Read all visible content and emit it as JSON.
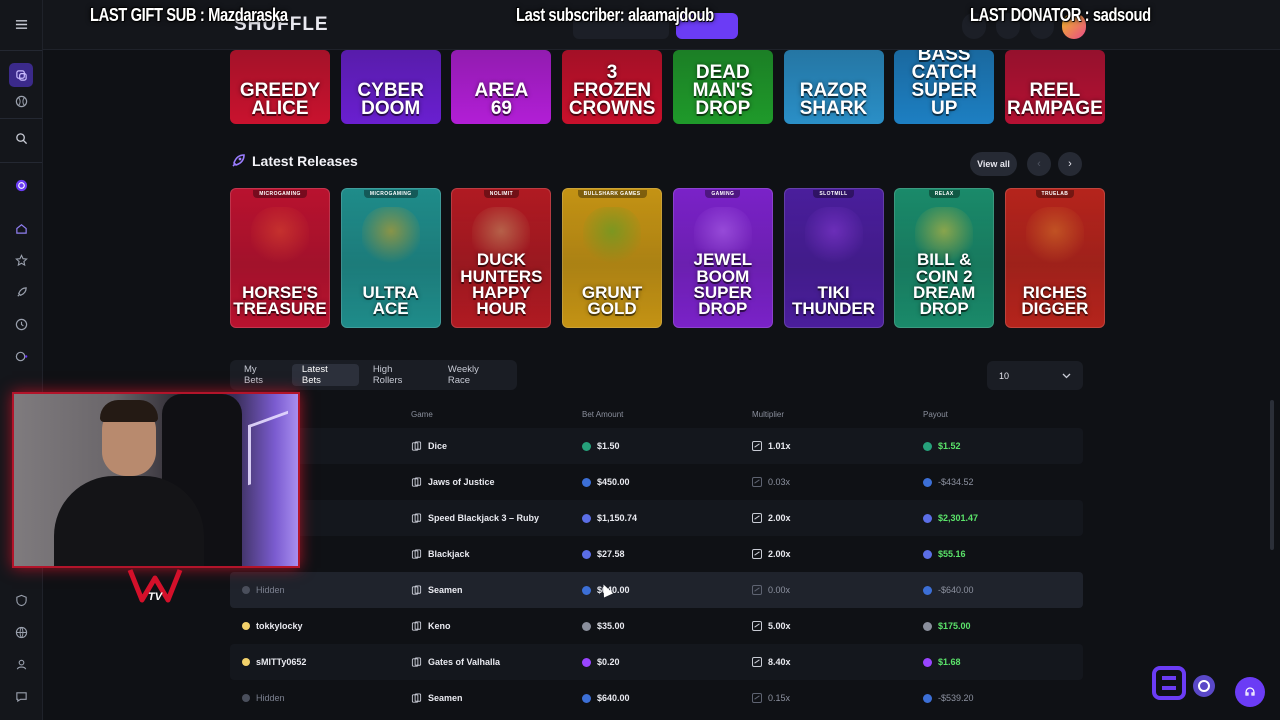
{
  "overlay": {
    "last_gift_sub": "LAST GIFT SUB : Mazdaraska",
    "last_subscriber": "Last subscriber: alaamajdoub",
    "last_donator": "LAST DONATOR : sadsoud"
  },
  "app": {
    "logo_text": "SHUFFLE"
  },
  "top_row_games": [
    {
      "title": "GREEDY\nALICE",
      "bg": "#c9122e"
    },
    {
      "title": "CYBER\nDOOM",
      "bg": "#6a1fd0"
    },
    {
      "title": "AREA\n69",
      "bg": "#b21ed6"
    },
    {
      "title": "3 FROZEN\nCROWNS",
      "bg": "#c8102b"
    },
    {
      "title": "DEAD MAN'S\nDROP",
      "bg": "#1f9a2a"
    },
    {
      "title": "RAZOR\nSHARK",
      "bg": "#2a8fc7"
    },
    {
      "title": "BASS CATCH\nSUPER UP",
      "bg": "#1d7fc2"
    },
    {
      "title": "REEL\nRAMPAGE",
      "bg": "#b61133"
    }
  ],
  "latest_releases": {
    "title": "Latest Releases",
    "view_all": "View all",
    "games": [
      {
        "title": "HORSE'S\nTREASURE",
        "provider": "MICROGAMING",
        "bg": "#b9122f",
        "accent": "#d94a2e"
      },
      {
        "title": "ULTRA\nACE",
        "provider": "MICROGAMING",
        "bg": "#1f8c8a",
        "accent": "#e0a21a"
      },
      {
        "title": "DUCK HUNTERS\nHAPPY HOUR",
        "provider": "NOLIMIT",
        "bg": "#b01a22",
        "accent": "#c49a6a"
      },
      {
        "title": "GRUNT\nGOLD",
        "provider": "BULLSHARK GAMES",
        "bg": "#c49314",
        "accent": "#4da12a"
      },
      {
        "title": "JEWEL BOOM\nSUPER DROP",
        "provider": "GAMING",
        "bg": "#7a22c8",
        "accent": "#b46cf0"
      },
      {
        "title": "TIKI\nTHUNDER",
        "provider": "SLOTMILL",
        "bg": "#4a1e9c",
        "accent": "#8a3cd8"
      },
      {
        "title": "BILL & COIN 2\nDREAM DROP",
        "provider": "RELAX",
        "bg": "#1a8a6a",
        "accent": "#e4c23a"
      },
      {
        "title": "RICHES\nDIGGER",
        "provider": "TRUELAB",
        "bg": "#b5241c",
        "accent": "#d4782a"
      }
    ]
  },
  "bets": {
    "tabs": [
      "My Bets",
      "Latest Bets",
      "High Rollers",
      "Weekly Race"
    ],
    "active_tab": "Latest Bets",
    "page_size": "10",
    "columns": [
      "Game",
      "Bet Amount",
      "Multiplier",
      "Payout"
    ],
    "rows": [
      {
        "user": "",
        "game": "Dice",
        "bet": "$1.50",
        "multiplier": "1.01x",
        "payout": "$1.52",
        "coin": "#26a17b",
        "win": true
      },
      {
        "user": "",
        "game": "Jaws of Justice",
        "bet": "$450.00",
        "multiplier": "0.03x",
        "payout": "-$434.52",
        "coin": "#3c6fd6",
        "win": false
      },
      {
        "user": "",
        "game": "Speed Blackjack 3 – Ruby",
        "bet": "$1,150.74",
        "multiplier": "2.00x",
        "payout": "$2,301.47",
        "coin": "#5b6ee6",
        "win": true
      },
      {
        "user": "",
        "game": "Blackjack",
        "bet": "$27.58",
        "multiplier": "2.00x",
        "payout": "$55.16",
        "coin": "#5b6ee6",
        "win": true
      },
      {
        "user": "Hidden",
        "game": "Seamen",
        "bet": "$640.00",
        "multiplier": "0.00x",
        "payout": "-$640.00",
        "coin": "#3c6fd6",
        "win": false
      },
      {
        "user": "tokkylocky",
        "game": "Keno",
        "bet": "$35.00",
        "multiplier": "5.00x",
        "payout": "$175.00",
        "coin": "#8a8f9c",
        "win": true
      },
      {
        "user": "sMITTy0652",
        "game": "Gates of Valhalla",
        "bet": "$0.20",
        "multiplier": "8.40x",
        "payout": "$1.68",
        "coin": "#9945ff",
        "win": true
      },
      {
        "user": "Hidden",
        "game": "Seamen",
        "bet": "$640.00",
        "multiplier": "0.15x",
        "payout": "-$539.20",
        "coin": "#3c6fd6",
        "win": false
      }
    ]
  }
}
